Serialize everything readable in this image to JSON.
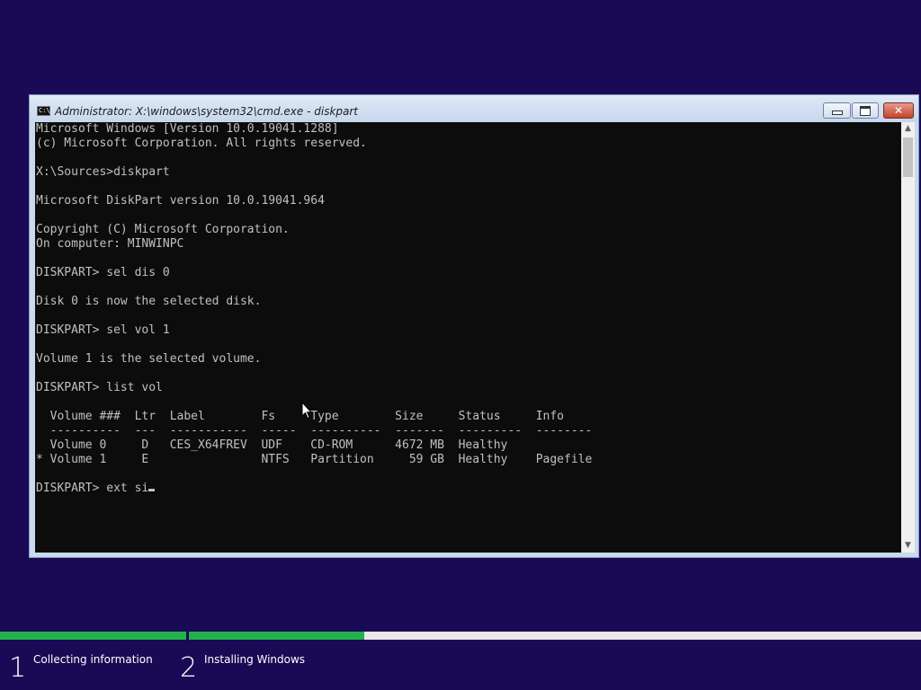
{
  "window": {
    "title": "Administrator: X:\\windows\\system32\\cmd.exe - diskpart",
    "icon": "cmd-icon",
    "icon_text": "C:\\",
    "controls": {
      "minimize": "minimize-icon",
      "maximize": "maximize-icon",
      "close": "close-icon",
      "close_glyph": "✕"
    }
  },
  "console": {
    "lines": [
      "Microsoft Windows [Version 10.0.19041.1288]",
      "(c) Microsoft Corporation. All rights reserved.",
      "",
      "X:\\Sources>diskpart",
      "",
      "Microsoft DiskPart version 10.0.19041.964",
      "",
      "Copyright (C) Microsoft Corporation.",
      "On computer: MINWINPC",
      "",
      "DISKPART> sel dis 0",
      "",
      "Disk 0 is now the selected disk.",
      "",
      "DISKPART> sel vol 1",
      "",
      "Volume 1 is the selected volume.",
      "",
      "DISKPART> list vol",
      "",
      "  Volume ###  Ltr  Label        Fs     Type        Size     Status     Info",
      "  ----------  ---  -----------  -----  ----------  -------  ---------  --------",
      "  Volume 0     D   CES_X64FREV  UDF    CD-ROM      4672 MB  Healthy",
      "* Volume 1     E                NTFS   Partition     59 GB  Healthy    Pagefile",
      ""
    ],
    "prompt_line": "DISKPART> ext si",
    "text_color": "#c0c0c0",
    "background": "#0c0c0c"
  },
  "scrollbar": {
    "up_arrow": "▲",
    "down_arrow": "▼"
  },
  "setup_progress": {
    "accent": "#23b24a",
    "steps": [
      {
        "number": "1",
        "label": "Collecting information",
        "progress": 1.0
      },
      {
        "number": "2",
        "label": "Installing Windows",
        "progress": 0.24
      }
    ]
  }
}
